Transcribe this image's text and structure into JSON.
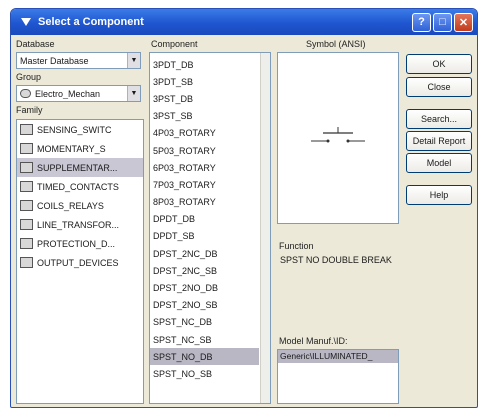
{
  "window": {
    "title": "Select a Component"
  },
  "titlebar": {
    "help": "?",
    "max": "□",
    "close": "✕"
  },
  "database": {
    "label": "Database",
    "value": "Master Database"
  },
  "group": {
    "label": "Group",
    "value": "Electro_Mechan"
  },
  "family": {
    "label": "Family",
    "items": [
      {
        "label": "SENSING_SWITC",
        "selected": false
      },
      {
        "label": "MOMENTARY_S",
        "selected": false
      },
      {
        "label": "SUPPLEMENTAR...",
        "selected": true
      },
      {
        "label": "TIMED_CONTACTS",
        "selected": false
      },
      {
        "label": "COILS_RELAYS",
        "selected": false
      },
      {
        "label": "LINE_TRANSFOR...",
        "selected": false
      },
      {
        "label": "PROTECTION_D...",
        "selected": false
      },
      {
        "label": "OUTPUT_DEVICES",
        "selected": false
      }
    ]
  },
  "component": {
    "label": "Component",
    "items": [
      {
        "label": "3PDT_DB",
        "selected": false
      },
      {
        "label": "3PDT_SB",
        "selected": false
      },
      {
        "label": "3PST_DB",
        "selected": false
      },
      {
        "label": "3PST_SB",
        "selected": false
      },
      {
        "label": "4P03_ROTARY",
        "selected": false
      },
      {
        "label": "5P03_ROTARY",
        "selected": false
      },
      {
        "label": "6P03_ROTARY",
        "selected": false
      },
      {
        "label": "7P03_ROTARY",
        "selected": false
      },
      {
        "label": "8P03_ROTARY",
        "selected": false
      },
      {
        "label": "DPDT_DB",
        "selected": false
      },
      {
        "label": "DPDT_SB",
        "selected": false
      },
      {
        "label": "DPST_2NC_DB",
        "selected": false
      },
      {
        "label": "DPST_2NC_SB",
        "selected": false
      },
      {
        "label": "DPST_2NO_DB",
        "selected": false
      },
      {
        "label": "DPST_2NO_SB",
        "selected": false
      },
      {
        "label": "SPST_NC_DB",
        "selected": false
      },
      {
        "label": "SPST_NC_SB",
        "selected": false
      },
      {
        "label": "SPST_NO_DB",
        "selected": true
      },
      {
        "label": "SPST_NO_SB",
        "selected": false
      }
    ]
  },
  "symbol": {
    "label": "Symbol (ANSI)"
  },
  "function": {
    "label": "Function",
    "text": "SPST NO DOUBLE BREAK"
  },
  "model": {
    "label": "Model Manuf.\\ID:",
    "value": "Generic\\ILLUMINATED_"
  },
  "buttons": {
    "ok": "OK",
    "close": "Close",
    "search": "Search...",
    "detail_report": "Detail Report",
    "model": "Model",
    "help": "Help"
  }
}
